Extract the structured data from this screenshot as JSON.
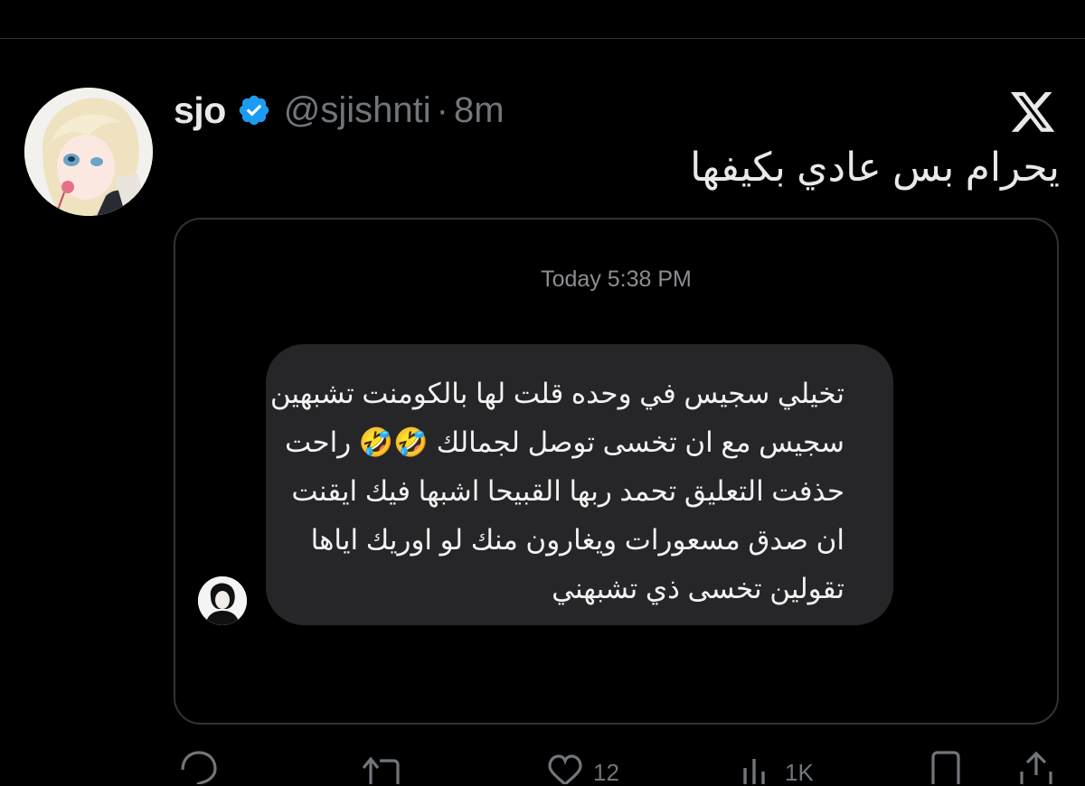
{
  "tweet": {
    "display_name": "sjo",
    "handle": "@sjishnti",
    "separator": "·",
    "time_ago": "8m",
    "text": "يحرام بس عادي بكيفها"
  },
  "media": {
    "timestamp": "Today 5:38 PM",
    "message_lines": [
      "تخيلي سجيس في وحده قلت لها بالكومنت تشبهين",
      "سجيس مع ان تخسى توصل لجمالك 🤣🤣 راحت",
      "حذفت التعليق تحمد ربها القبيحا اشبها فيك ايقنت",
      "ان صدق مسعورات ويغارون منك لو اوريك اياها",
      "تقولين تخسى ذي تشبهني"
    ]
  },
  "actions": {
    "like_count": "12",
    "views_count": "1K"
  },
  "icons": {
    "verified": "verified-badge-icon",
    "x_logo": "x-logo-icon",
    "reply": "reply-icon",
    "retweet": "retweet-icon",
    "like": "heart-icon",
    "views": "views-chart-icon",
    "bookmark": "bookmark-icon",
    "share": "share-icon"
  },
  "colors": {
    "background": "#000000",
    "text_primary": "#e7e9ea",
    "text_secondary": "#71767b",
    "verified_blue": "#1d9bf0",
    "bubble": "#262629",
    "border": "#2f3336"
  }
}
